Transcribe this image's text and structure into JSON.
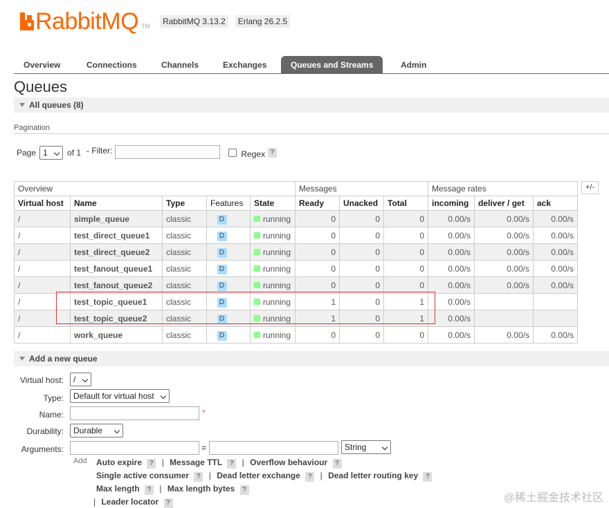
{
  "header": {
    "logo_text": "RabbitMQ",
    "logo_tm": "TM",
    "rabbitmq_version": "RabbitMQ 3.13.2",
    "erlang_version": "Erlang 26.2.5"
  },
  "tabs": [
    {
      "label": "Overview",
      "active": false
    },
    {
      "label": "Connections",
      "active": false
    },
    {
      "label": "Channels",
      "active": false
    },
    {
      "label": "Exchanges",
      "active": false
    },
    {
      "label": "Queues and Streams",
      "active": true
    },
    {
      "label": "Admin",
      "active": false
    }
  ],
  "page_title": "Queues",
  "all_queues_label": "All queues (8)",
  "pagination": {
    "label": "Pagination",
    "page_label": "Page",
    "page_value": "1",
    "of_label": "of 1",
    "filter_label": "- Filter:",
    "filter_value": "",
    "regex_label": "Regex",
    "help": "?"
  },
  "table": {
    "groups": [
      "Overview",
      "Messages",
      "Message rates"
    ],
    "plus_minus": "+/-",
    "columns": [
      "Virtual host",
      "Name",
      "Type",
      "Features",
      "State",
      "Ready",
      "Unacked",
      "Total",
      "incoming",
      "deliver / get",
      "ack"
    ],
    "rows": [
      {
        "vhost": "/",
        "name": "simple_queue",
        "type": "classic",
        "feature": "D",
        "state": "running",
        "ready": "0",
        "unacked": "0",
        "total": "0",
        "incoming": "0.00/s",
        "deliver": "0.00/s",
        "ack": "0.00/s"
      },
      {
        "vhost": "/",
        "name": "test_direct_queue1",
        "type": "classic",
        "feature": "D",
        "state": "running",
        "ready": "0",
        "unacked": "0",
        "total": "0",
        "incoming": "0.00/s",
        "deliver": "0.00/s",
        "ack": "0.00/s"
      },
      {
        "vhost": "/",
        "name": "test_direct_queue2",
        "type": "classic",
        "feature": "D",
        "state": "running",
        "ready": "0",
        "unacked": "0",
        "total": "0",
        "incoming": "0.00/s",
        "deliver": "0.00/s",
        "ack": "0.00/s"
      },
      {
        "vhost": "/",
        "name": "test_fanout_queue1",
        "type": "classic",
        "feature": "D",
        "state": "running",
        "ready": "0",
        "unacked": "0",
        "total": "0",
        "incoming": "0.00/s",
        "deliver": "0.00/s",
        "ack": "0.00/s"
      },
      {
        "vhost": "/",
        "name": "test_fanout_queue2",
        "type": "classic",
        "feature": "D",
        "state": "running",
        "ready": "0",
        "unacked": "0",
        "total": "0",
        "incoming": "0.00/s",
        "deliver": "0.00/s",
        "ack": "0.00/s"
      },
      {
        "vhost": "/",
        "name": "test_topic_queue1",
        "type": "classic",
        "feature": "D",
        "state": "running",
        "ready": "1",
        "unacked": "0",
        "total": "1",
        "incoming": "0.00/s",
        "deliver": "",
        "ack": ""
      },
      {
        "vhost": "/",
        "name": "test_topic_queue2",
        "type": "classic",
        "feature": "D",
        "state": "running",
        "ready": "1",
        "unacked": "0",
        "total": "1",
        "incoming": "0.00/s",
        "deliver": "",
        "ack": ""
      },
      {
        "vhost": "/",
        "name": "work_queue",
        "type": "classic",
        "feature": "D",
        "state": "running",
        "ready": "0",
        "unacked": "0",
        "total": "0",
        "incoming": "0.00/s",
        "deliver": "0.00/s",
        "ack": "0.00/s"
      }
    ]
  },
  "add_queue": {
    "section_label": "Add a new queue",
    "virtual_host_label": "Virtual host:",
    "virtual_host_value": "/",
    "type_label": "Type:",
    "type_value": "Default for virtual host",
    "name_label": "Name:",
    "name_value": "",
    "required_mark": "*",
    "durability_label": "Durability:",
    "durability_value": "Durable",
    "arguments_label": "Arguments:",
    "equals": "=",
    "arg_type_value": "String",
    "add_label": "Add",
    "separator": "|",
    "argument_links": {
      "auto_expire": "Auto expire",
      "message_ttl": "Message TTL",
      "overflow_behaviour": "Overflow behaviour",
      "single_active_consumer": "Single active consumer",
      "dead_letter_exchange": "Dead letter exchange",
      "dead_letter_routing_key": "Dead letter routing key",
      "max_length": "Max length",
      "max_length_bytes": "Max length bytes",
      "leader_locator": "Leader locator"
    }
  },
  "watermark": "@稀土掘金技术社区",
  "colors": {
    "logo": "#ff6600",
    "active_tab": "#666666",
    "running": "#88ff88",
    "durable_badge": "#aadcff",
    "highlight_box": "#dd3333"
  }
}
